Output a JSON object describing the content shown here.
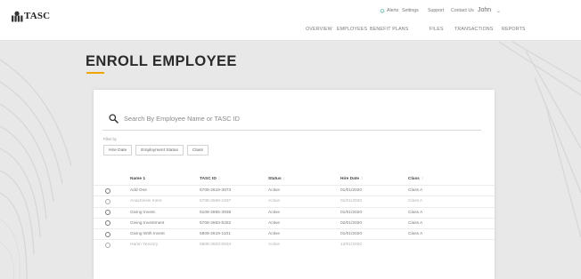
{
  "app": {
    "logo_text": "TASC"
  },
  "utility_nav": {
    "alerts": "Alerts",
    "settings": "Settings",
    "support": "Support",
    "contact": "Contact Us",
    "user": "John"
  },
  "main_nav": [
    "OVERVIEW",
    "EMPLOYEES",
    "BENEFIT PLANS",
    "FILES",
    "TRANSACTIONS",
    "REPORTS"
  ],
  "page": {
    "title": "ENROLL EMPLOYEE"
  },
  "search": {
    "placeholder": "Search By Employee Name or TASC ID"
  },
  "filters": {
    "label": "Filter by",
    "chips": [
      "Hire Date",
      "Employment Status",
      "Class"
    ]
  },
  "table": {
    "headers": {
      "name": "Name 1",
      "id": "TASC ID",
      "status": "Status",
      "hire": "Hire Date",
      "class": "Class"
    },
    "rows": [
      {
        "name": "Add One",
        "id": "5708-2619-3873",
        "status": "Active",
        "hire": "01/01/2020",
        "class": "Class A"
      },
      {
        "name": "Anachnisin Inere",
        "id": "5708-2568-1937",
        "status": "Active",
        "hire": "01/01/2020",
        "class": "Class A"
      },
      {
        "name": "Giving Invest.",
        "id": "5108-2865-3938",
        "status": "Active",
        "hire": "01/01/2020",
        "class": "Class A"
      },
      {
        "name": "Giving Investment",
        "id": "5708-2863-5252",
        "status": "Active",
        "hire": "02/01/2020",
        "class": "Class A"
      },
      {
        "name": "Giving With Invest",
        "id": "5808-2619-1101",
        "status": "Active",
        "hire": "01/01/2020",
        "class": "Class A"
      },
      {
        "name": "Harim Yenzory",
        "id": "5808-2503-0534",
        "status": "Active",
        "hire": "13/01/2020",
        "class": ""
      }
    ]
  },
  "colors": {
    "accent": "#f0a500",
    "page_bg": "#e9e9e9",
    "card_bg": "#ffffff"
  }
}
